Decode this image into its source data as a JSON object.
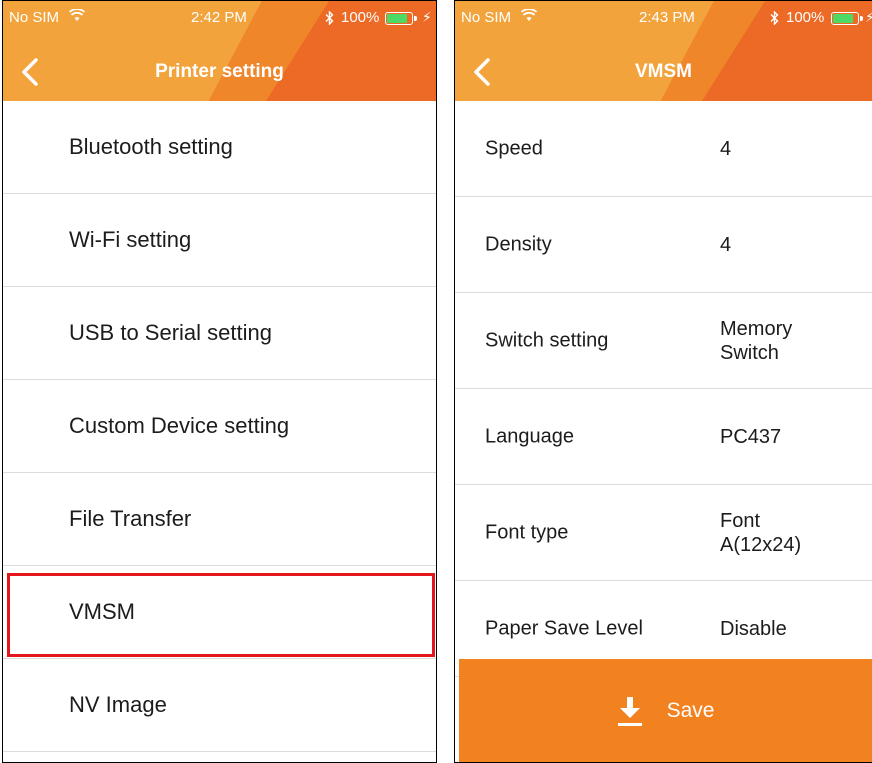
{
  "left_screen": {
    "status": {
      "carrier": "No SIM",
      "time": "2:42 PM",
      "battery_percent": "100%"
    },
    "title": "Printer setting",
    "menu_items": [
      {
        "label": "Bluetooth setting"
      },
      {
        "label": "Wi-Fi setting"
      },
      {
        "label": "USB to Serial setting"
      },
      {
        "label": "Custom Device setting"
      },
      {
        "label": "File Transfer"
      },
      {
        "label": "VMSM"
      },
      {
        "label": "NV Image"
      }
    ],
    "highlighted_item": "VMSM"
  },
  "right_screen": {
    "status": {
      "carrier": "No SIM",
      "time": "2:43 PM",
      "battery_percent": "100%"
    },
    "title": "VMSM",
    "settings": [
      {
        "label": "Speed",
        "value": "4"
      },
      {
        "label": "Density",
        "value": "4"
      },
      {
        "label": "Switch setting",
        "value": "Memory Switch"
      },
      {
        "label": "Language",
        "value": "PC437"
      },
      {
        "label": "Font type",
        "value": "Font A(12x24)"
      },
      {
        "label": "Paper Save Level",
        "value": "Disable"
      }
    ],
    "save_label": "Save"
  },
  "colors": {
    "header_orange": "#f0862a",
    "header_light": "#f3a33c",
    "header_dark": "#ec6a25",
    "save_orange": "#f1821f",
    "highlight_red": "#e4161b",
    "battery_green": "#4cd964"
  },
  "icons": [
    "wifi-icon",
    "bluetooth-icon",
    "battery-icon",
    "charging-icon",
    "back-chevron-icon",
    "download-icon"
  ]
}
